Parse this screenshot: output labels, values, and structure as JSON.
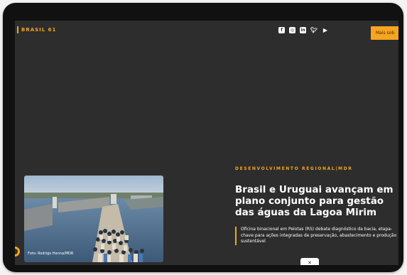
{
  "header": {
    "brand": "BRASIL 61",
    "social_icons": [
      "facebook-icon",
      "instagram-icon",
      "linkedin-icon",
      "twitter-icon",
      "youtube-icon"
    ],
    "more_button_label": "Mais sob"
  },
  "article": {
    "category": "DESENVOLVIMENTO REGIONAL|MDR",
    "headline": "Brasil e Uruguai avançam em plano conjunto para gestão das águas da Lagoa Mirim",
    "summary": "Oficina binacional em Pelotas (RS) debate diagnóstico da bacia, etapa-chave para ações integradas de preservação, abastecimento e produção sustentável",
    "photo_credit": "Foto: Rodrigo Hanna/MDR"
  },
  "colors": {
    "accent": "#f5a51f",
    "background": "#2d2d2d",
    "frame": "#111111"
  }
}
